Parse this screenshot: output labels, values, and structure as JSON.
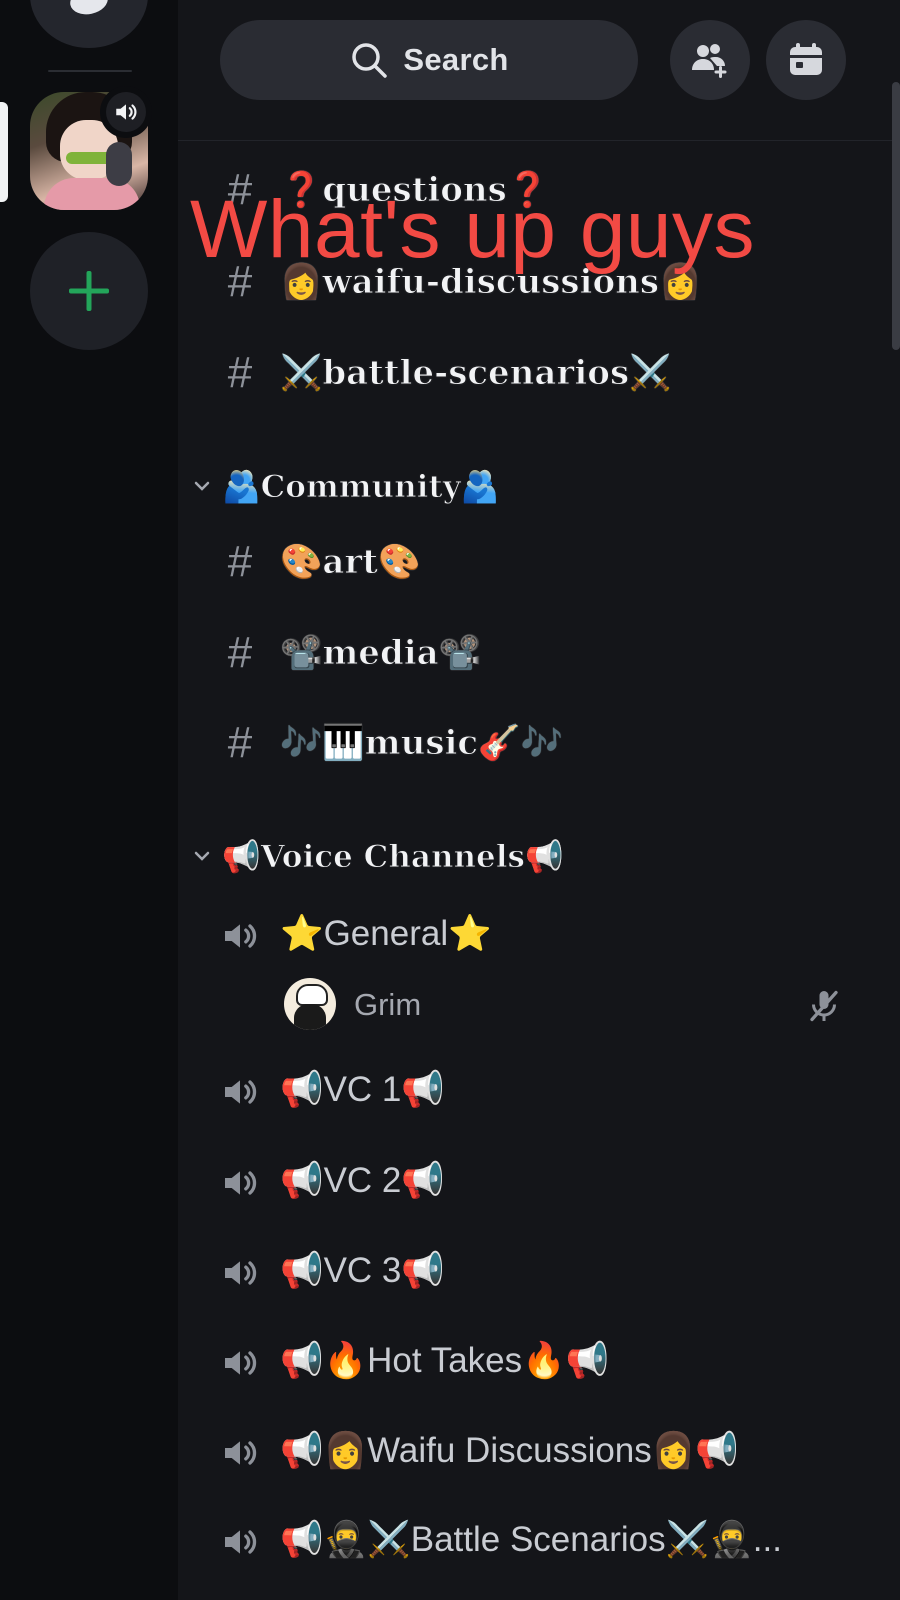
{
  "search": {
    "label": "Search"
  },
  "overlay": {
    "caption": "What's up guys"
  },
  "text_channels_top": [
    {
      "name": "❓questions❓"
    },
    {
      "name": "👩waifu-discussions👩"
    },
    {
      "name": "⚔️battle-scenarios⚔️"
    }
  ],
  "community": {
    "title": "🫂Community🫂",
    "channels": [
      {
        "name": "🎨art🎨"
      },
      {
        "name": "📽️media📽️"
      },
      {
        "name": "🎶🎹music🎸🎶"
      }
    ]
  },
  "voice": {
    "title": "📢Voice Channels📢",
    "channels": [
      {
        "name": "⭐General⭐"
      },
      {
        "name": "📢VC 1📢"
      },
      {
        "name": "📢VC 2📢"
      },
      {
        "name": "📢VC 3📢"
      },
      {
        "name": "📢🔥Hot Takes🔥📢"
      },
      {
        "name": "📢👩Waifu Discussions👩📢"
      },
      {
        "name": "📢🥷⚔️Battle Scenarios⚔️🥷..."
      }
    ],
    "general_member": {
      "name": "Grim",
      "muted": true
    }
  },
  "glyphs": {
    "hash": "#"
  },
  "colors": {
    "background": "#141519",
    "rail": "#0c0d10",
    "add_green": "#23a55a",
    "caption_red": "#f24a44"
  }
}
